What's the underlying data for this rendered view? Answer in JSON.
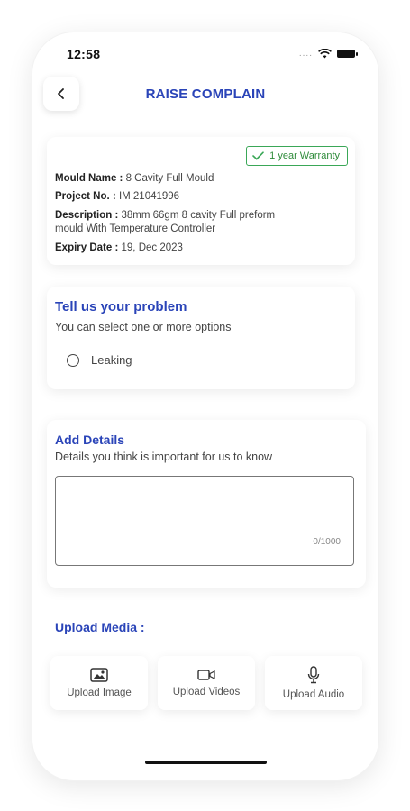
{
  "status_bar": {
    "time": "12:58",
    "signal": "....",
    "wifi_icon": "wifi-icon",
    "battery_icon": "battery-icon"
  },
  "header": {
    "back_icon": "chevron-left-icon",
    "title": "RAISE COMPLAIN"
  },
  "info_card": {
    "warranty_badge": "1 year Warranty",
    "warranty_icon": "check-icon",
    "mould_name_label": "Mould Name :",
    "mould_name": "8 Cavity Full Mould",
    "project_no_label": "Project No. :",
    "project_no": "IM 21041996",
    "description_label": "Description :",
    "description_line1": "38mm 66gm 8 cavity Full preform",
    "description_line2": "mould  With Temperature Controller",
    "expiry_label": "Expiry Date :",
    "expiry_date": "19, Dec 2023"
  },
  "problem_section": {
    "title": "Tell us your problem",
    "subtitle": "You can select one or more options",
    "options": [
      {
        "label": "Leaking",
        "selected": false
      }
    ]
  },
  "details_section": {
    "title": "Add Details",
    "subtitle": "Details you think is important for us to know",
    "input_value": "",
    "counter": "0/1000"
  },
  "upload_section": {
    "title": "Upload Media :",
    "buttons": [
      {
        "label": "Upload Image",
        "icon": "image-icon"
      },
      {
        "label": "Upload Videos",
        "icon": "video-icon"
      },
      {
        "label": "Upload Audio",
        "icon": "microphone-icon"
      }
    ]
  },
  "colors": {
    "accent": "#2a44b8",
    "warranty": "#2e8b3a"
  }
}
